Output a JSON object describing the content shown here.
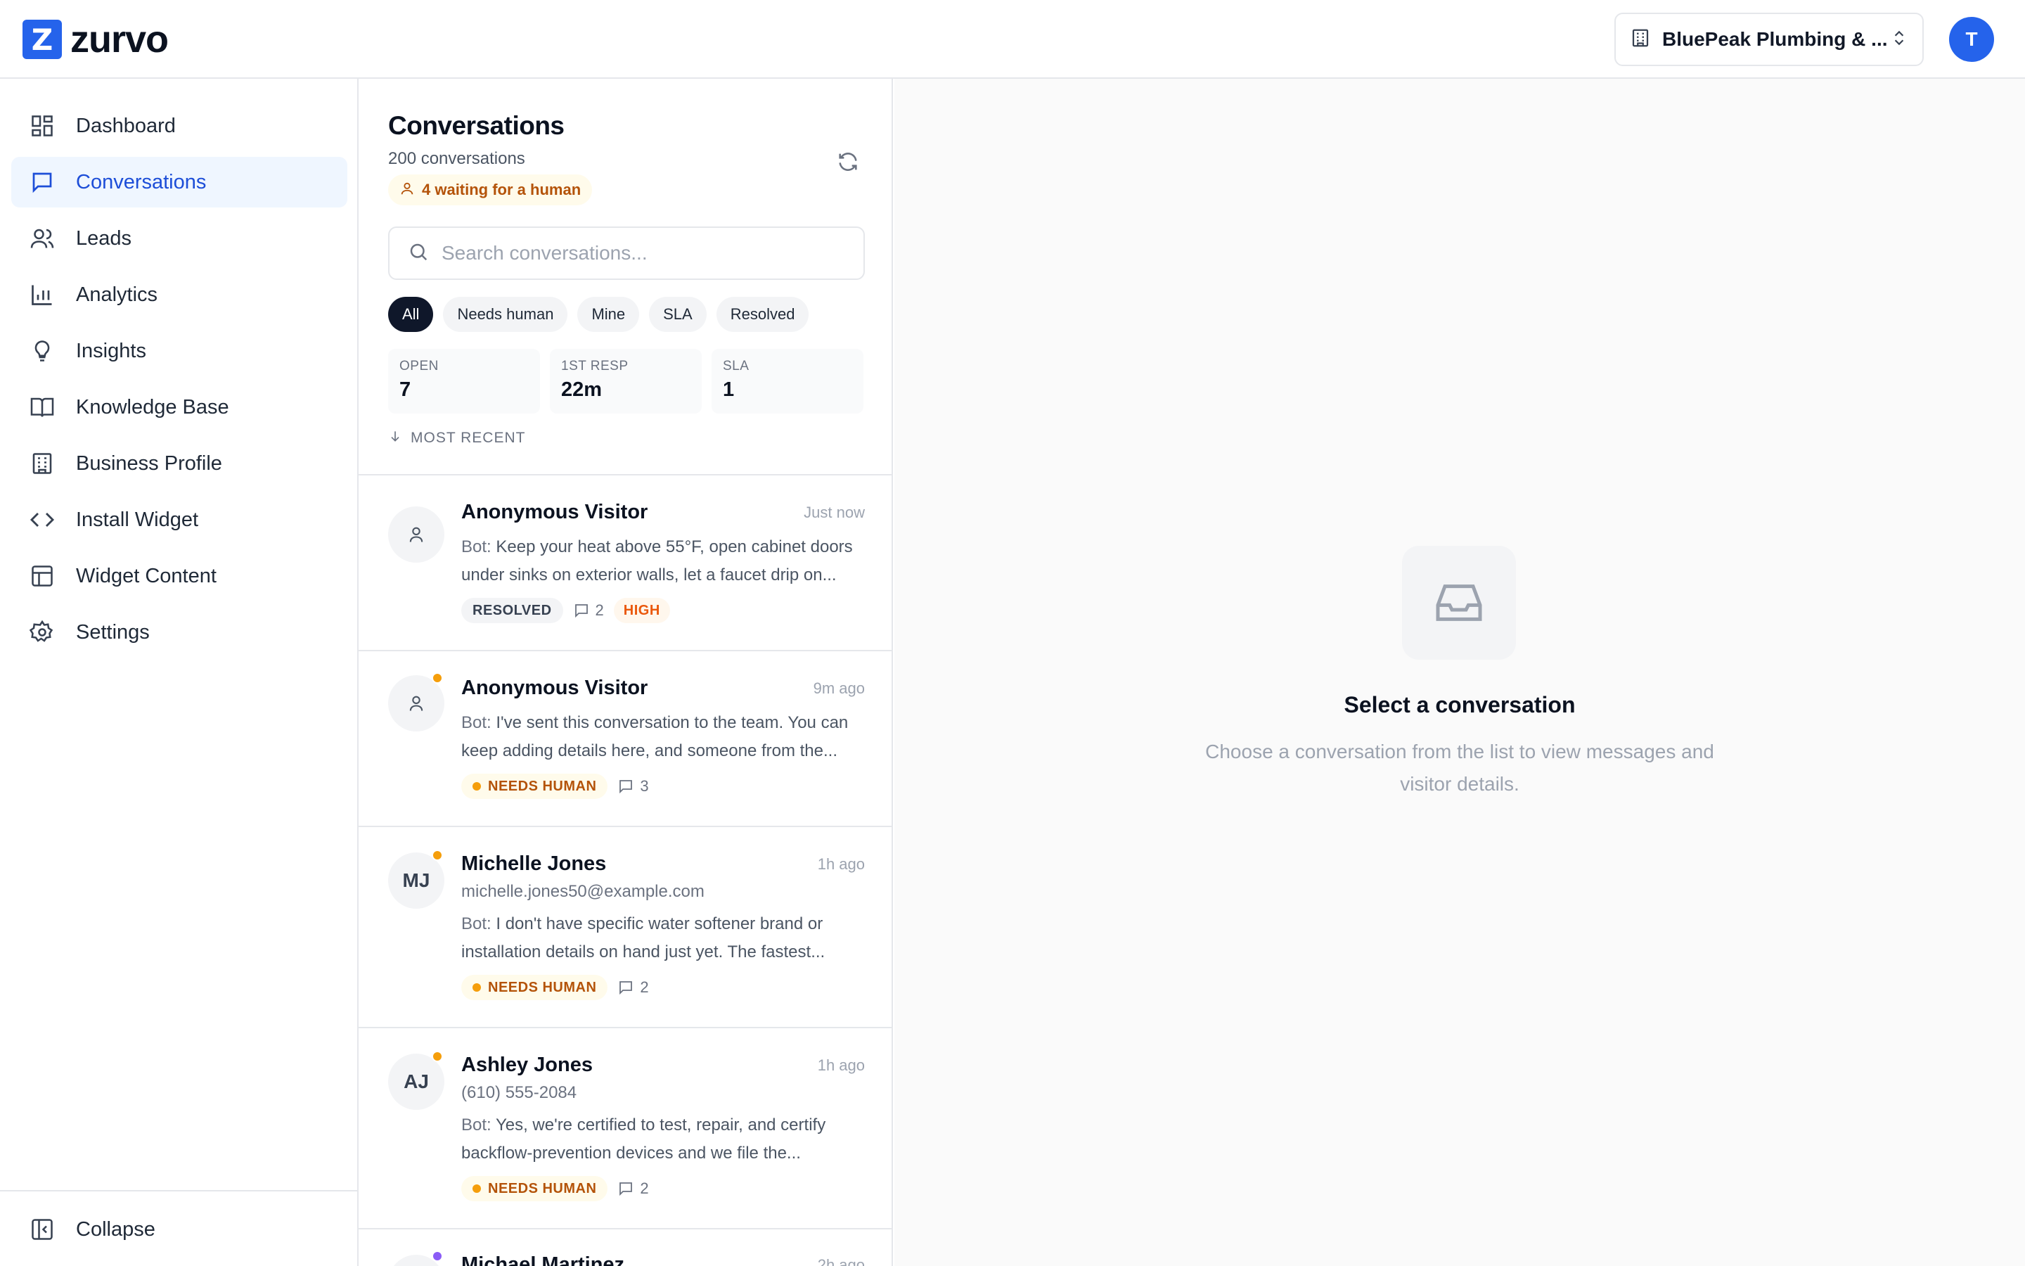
{
  "app": {
    "logo_letter": "Z",
    "logo_text": "zurvo",
    "business_name": "BluePeak Plumbing & ...",
    "user_initial": "T",
    "accent_color": "#2563eb"
  },
  "sidebar": {
    "items": [
      {
        "label": "Dashboard",
        "icon": "dashboard-icon"
      },
      {
        "label": "Conversations",
        "icon": "chat-icon",
        "active": true
      },
      {
        "label": "Leads",
        "icon": "users-icon"
      },
      {
        "label": "Analytics",
        "icon": "bar-chart-icon"
      },
      {
        "label": "Insights",
        "icon": "lightbulb-icon"
      },
      {
        "label": "Knowledge Base",
        "icon": "book-icon"
      },
      {
        "label": "Business Profile",
        "icon": "building-icon"
      },
      {
        "label": "Install Widget",
        "icon": "code-icon"
      },
      {
        "label": "Widget Content",
        "icon": "layout-icon"
      },
      {
        "label": "Settings",
        "icon": "gear-icon"
      }
    ],
    "collapse_label": "Collapse"
  },
  "conversations": {
    "title": "Conversations",
    "count_text": "200 conversations",
    "waiting_text": "4 waiting for a human",
    "search_placeholder": "Search conversations...",
    "filters": [
      "All",
      "Needs human",
      "Mine",
      "SLA",
      "Resolved"
    ],
    "active_filter": "All",
    "stats": [
      {
        "label": "OPEN",
        "value": "7"
      },
      {
        "label": "1ST RESP",
        "value": "22m"
      },
      {
        "label": "SLA",
        "value": "1"
      }
    ],
    "sort_label": "MOST RECENT",
    "items": [
      {
        "name": "Anonymous Visitor",
        "time": "Just now",
        "bot_prefix": "Bot:",
        "preview": "Keep your heat above 55°F, open cabinet doors under sinks on exterior walls, let a faucet drip on...",
        "status": "RESOLVED",
        "messages": "2",
        "priority": "HIGH"
      },
      {
        "name": "Anonymous Visitor",
        "time": "9m ago",
        "bot_prefix": "Bot:",
        "preview": "I've sent this conversation to the team. You can keep adding details here, and someone from the...",
        "status": "NEEDS HUMAN",
        "messages": "3",
        "dot_color": "#f59e0b"
      },
      {
        "name": "Michelle Jones",
        "initials": "MJ",
        "contact": "michelle.jones50@example.com",
        "time": "1h ago",
        "bot_prefix": "Bot:",
        "preview": "I don't have specific water softener brand or installation details on hand just yet. The fastest...",
        "status": "NEEDS HUMAN",
        "messages": "2",
        "dot_color": "#f59e0b"
      },
      {
        "name": "Ashley Jones",
        "initials": "AJ",
        "contact": "(610) 555-2084",
        "time": "1h ago",
        "bot_prefix": "Bot:",
        "preview": "Yes, we're certified to test, repair, and certify backflow-prevention devices and we file the...",
        "status": "NEEDS HUMAN",
        "messages": "2",
        "dot_color": "#f59e0b"
      },
      {
        "name": "Michael Martinez",
        "time": "2h ago",
        "dot_color": "#8b5cf6"
      }
    ]
  },
  "empty_state": {
    "title": "Select a conversation",
    "description": "Choose a conversation from the list to view messages and visitor details."
  }
}
